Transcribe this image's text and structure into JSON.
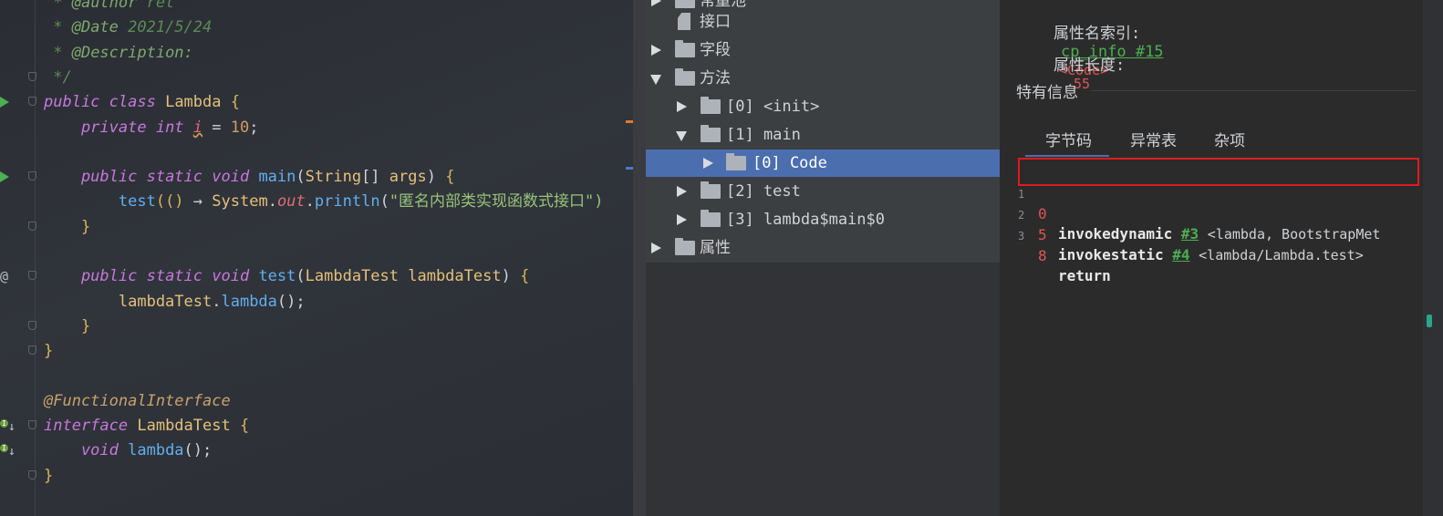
{
  "editor": {
    "lines": [
      {
        "segments": [
          {
            "t": " * ",
            "c": "doc"
          },
          {
            "t": "@author",
            "c": "doctag"
          },
          {
            "t": " ret",
            "c": "doc"
          }
        ]
      },
      {
        "segments": [
          {
            "t": " * ",
            "c": "doc"
          },
          {
            "t": "@Date",
            "c": "doctag"
          },
          {
            "t": " 2021/5/24",
            "c": "doc"
          }
        ]
      },
      {
        "segments": [
          {
            "t": " * ",
            "c": "doc"
          },
          {
            "t": "@Description:",
            "c": "doctag"
          }
        ]
      },
      {
        "segments": [
          {
            "t": " */",
            "c": "doc"
          }
        ]
      },
      {
        "segments": [
          {
            "t": "public ",
            "c": "kwi"
          },
          {
            "t": "class ",
            "c": "kwi"
          },
          {
            "t": "Lambda ",
            "c": "cls"
          },
          {
            "t": "{",
            "c": "brace"
          }
        ]
      },
      {
        "segments": [
          {
            "t": "    private ",
            "c": "kwi"
          },
          {
            "t": "int ",
            "c": "kwi"
          },
          {
            "t": "i",
            "c": "fldi"
          },
          {
            "t": " = ",
            "c": "plain"
          },
          {
            "t": "10",
            "c": "num"
          },
          {
            "t": ";",
            "c": "plain"
          }
        ]
      },
      {
        "segments": []
      },
      {
        "segments": [
          {
            "t": "    public ",
            "c": "kwi"
          },
          {
            "t": "static ",
            "c": "kwi"
          },
          {
            "t": "void ",
            "c": "kwi"
          },
          {
            "t": "main",
            "c": "fn"
          },
          {
            "t": "(",
            "c": "plain"
          },
          {
            "t": "String",
            "c": "cls"
          },
          {
            "t": "[] ",
            "c": "plain"
          },
          {
            "t": "args",
            "c": "par"
          },
          {
            "t": ") ",
            "c": "plain"
          },
          {
            "t": "{",
            "c": "brace"
          }
        ]
      },
      {
        "segments": [
          {
            "t": "        test",
            "c": "fn"
          },
          {
            "t": "(() ",
            "c": "brace"
          },
          {
            "t": "→ ",
            "c": "plain"
          },
          {
            "t": "System",
            "c": "cls"
          },
          {
            "t": ".",
            "c": "plain"
          },
          {
            "t": "out",
            "c": "stat"
          },
          {
            "t": ".",
            "c": "plain"
          },
          {
            "t": "println",
            "c": "fn"
          },
          {
            "t": "(",
            "c": "plain"
          },
          {
            "t": "\"匿名内部类实现函数式接口\")",
            "c": "str"
          }
        ]
      },
      {
        "segments": [
          {
            "t": "    }",
            "c": "brace"
          }
        ]
      },
      {
        "segments": []
      },
      {
        "segments": [
          {
            "t": "    public ",
            "c": "kwi"
          },
          {
            "t": "static ",
            "c": "kwi"
          },
          {
            "t": "void ",
            "c": "kwi"
          },
          {
            "t": "test",
            "c": "fn"
          },
          {
            "t": "(",
            "c": "plain"
          },
          {
            "t": "LambdaTest ",
            "c": "cls"
          },
          {
            "t": "lambdaTest",
            "c": "par"
          },
          {
            "t": ") ",
            "c": "plain"
          },
          {
            "t": "{",
            "c": "brace"
          }
        ]
      },
      {
        "segments": [
          {
            "t": "        lambdaTest",
            "c": "par"
          },
          {
            "t": ".",
            "c": "plain"
          },
          {
            "t": "lambda",
            "c": "fn"
          },
          {
            "t": "();",
            "c": "plain"
          }
        ]
      },
      {
        "segments": [
          {
            "t": "    }",
            "c": "brace"
          }
        ]
      },
      {
        "segments": [
          {
            "t": "}",
            "c": "brace"
          }
        ]
      },
      {
        "segments": []
      },
      {
        "segments": [
          {
            "t": "@FunctionalInterface",
            "c": "ann"
          }
        ]
      },
      {
        "segments": [
          {
            "t": "interface ",
            "c": "kwi"
          },
          {
            "t": "LambdaTest ",
            "c": "cls"
          },
          {
            "t": "{",
            "c": "brace"
          }
        ]
      },
      {
        "segments": [
          {
            "t": "    void ",
            "c": "kwi"
          },
          {
            "t": "lambda",
            "c": "fn"
          },
          {
            "t": "();",
            "c": "plain"
          }
        ]
      },
      {
        "segments": [
          {
            "t": "}",
            "c": "brace"
          }
        ]
      }
    ]
  },
  "tree": {
    "items": [
      {
        "label": "常量池"
      },
      {
        "label": "接口"
      },
      {
        "label": "字段"
      },
      {
        "label": "方法"
      },
      {
        "label": "[0] <init>"
      },
      {
        "label": "[1] main"
      },
      {
        "label": "[0] Code"
      },
      {
        "label": "[2] test"
      },
      {
        "label": "[3] lambda$main$0"
      },
      {
        "label": "属性"
      }
    ]
  },
  "info": {
    "name_index_label": "属性名索引:",
    "name_index_link": "cp_info #15",
    "name_index_tag": "<Code>",
    "length_label": "属性长度:",
    "length_value": "55",
    "section_title": "特有信息",
    "tabs": [
      "字节码",
      "异常表",
      "杂项"
    ],
    "bytecode": [
      {
        "line": "1",
        "offset": "0",
        "op": "invokedynamic",
        "ref": "#3",
        "comment": "<lambda, BootstrapMet"
      },
      {
        "line": "2",
        "offset": "5",
        "op": "invokestatic",
        "ref": "#4",
        "comment": "<lambda/Lambda.test>"
      },
      {
        "line": "3",
        "offset": "8",
        "op": "return",
        "ref": "",
        "comment": ""
      }
    ]
  },
  "colors": {
    "accent": "#4b6eaf",
    "highlight": "#e21b1b",
    "link": "#4caf50"
  }
}
